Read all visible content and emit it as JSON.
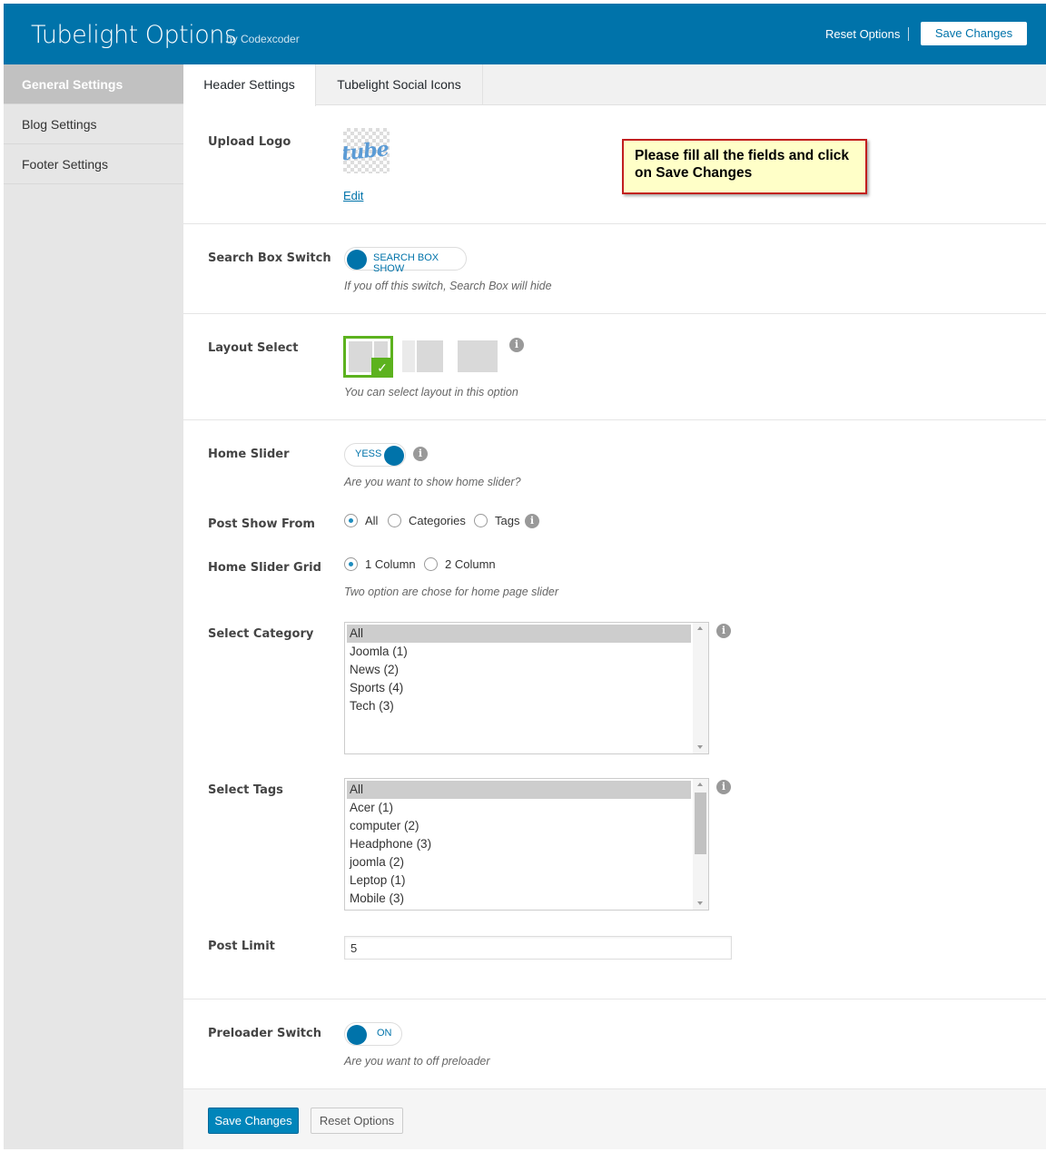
{
  "header": {
    "title": "Tubelight Options",
    "byline": "by Codexcoder",
    "reset_label": "Reset Options",
    "save_label": "Save Changes"
  },
  "sidebar": {
    "items": [
      {
        "label": "General Settings",
        "active": true
      },
      {
        "label": "Blog Settings",
        "active": false
      },
      {
        "label": "Footer Settings",
        "active": false
      }
    ]
  },
  "tabs": [
    {
      "label": "Header Settings",
      "active": true
    },
    {
      "label": "Tubelight Social Icons",
      "active": false
    }
  ],
  "upload_logo": {
    "label": "Upload Logo",
    "logo_text": "tubelight",
    "edit_label": "Edit"
  },
  "callout": {
    "text": "Please fill all the fields and click on Save Changes"
  },
  "search_box": {
    "label": "Search Box Switch",
    "toggle_text": "SEARCH BOX SHOW",
    "description": "If you off this switch, Search Box will hide"
  },
  "layout_select": {
    "label": "Layout Select",
    "description": "You can select layout in this option",
    "info_icon": "i"
  },
  "home_slider": {
    "label": "Home Slider",
    "toggle_text": "YESS",
    "description": "Are you want to show home slider?",
    "info_icon": "i"
  },
  "post_show_from": {
    "label": "Post Show From",
    "options": [
      "All",
      "Categories",
      "Tags"
    ],
    "selected": "All",
    "info_icon": "i"
  },
  "home_slider_grid": {
    "label": "Home Slider Grid",
    "options": [
      "1 Column",
      "2 Column"
    ],
    "selected": "1 Column",
    "description": "Two option are chose for home page slider"
  },
  "select_category": {
    "label": "Select Category",
    "options": [
      "All",
      "Joomla (1)",
      "News (2)",
      "Sports (4)",
      "Tech (3)"
    ],
    "selected": "All",
    "info_icon": "i"
  },
  "select_tags": {
    "label": "Select Tags",
    "options": [
      "All",
      "Acer (1)",
      "computer (2)",
      "Headphone (3)",
      "joomla (2)",
      "Leptop (1)",
      "Mobile (3)"
    ],
    "selected": "All",
    "info_icon": "i"
  },
  "post_limit": {
    "label": "Post Limit",
    "value": "5"
  },
  "preloader": {
    "label": "Preloader Switch",
    "toggle_text": "ON",
    "description": "Are you want to off preloader"
  },
  "footer": {
    "save_label": "Save Changes",
    "reset_label": "Reset Options"
  },
  "colors": {
    "brand": "#0073aa",
    "selected_layout": "#5cb21e",
    "callout_border": "#c21f1f",
    "callout_bg": "#ffffc8"
  }
}
